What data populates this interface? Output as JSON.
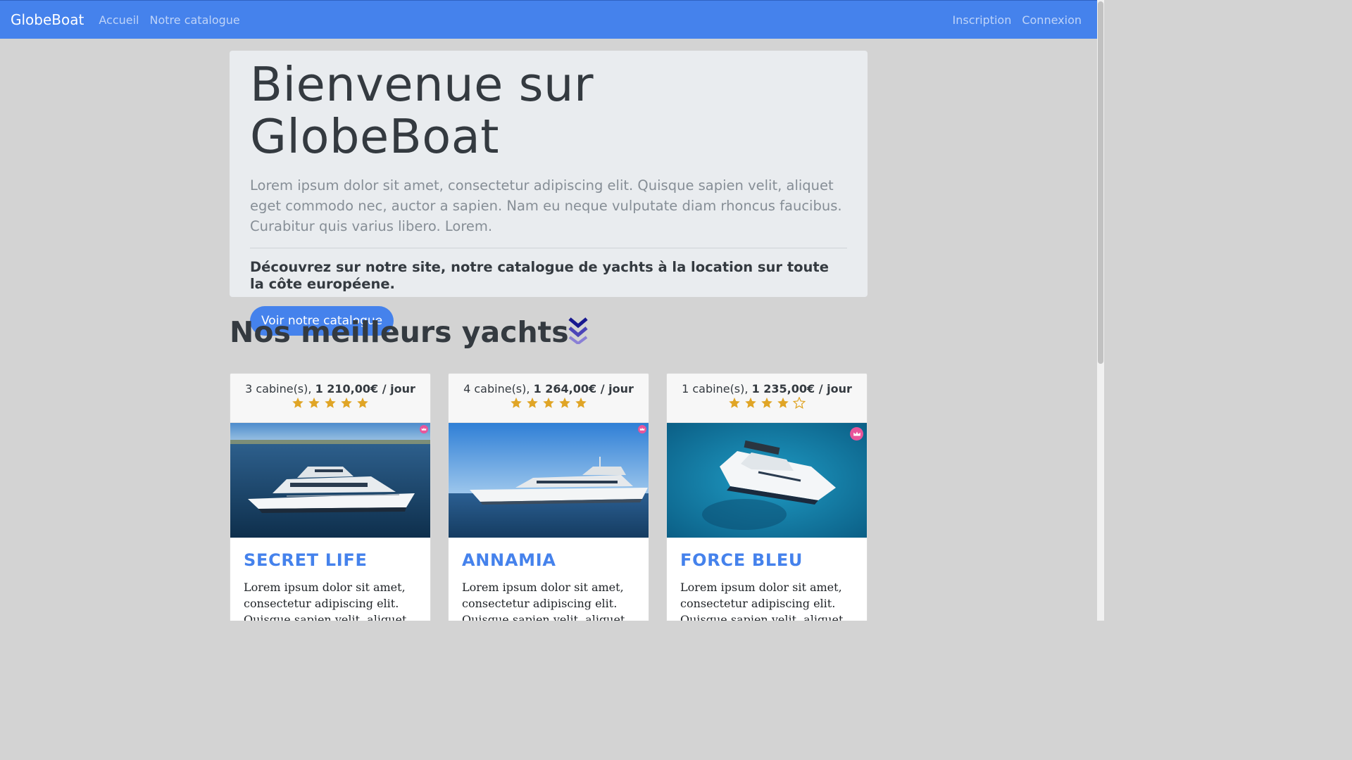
{
  "navbar": {
    "brand": "GlobeBoat",
    "links": [
      "Accueil",
      "Notre catalogue"
    ],
    "right_links": [
      "Inscription",
      "Connexion"
    ]
  },
  "jumbotron": {
    "title": "Bienvenue sur GlobeBoat",
    "lead": "Lorem ipsum dolor sit amet, consectetur adipiscing elit. Quisque sapien velit, aliquet eget commodo nec, auctor a sapien. Nam eu neque vulputate diam rhoncus faucibus. Curabitur quis varius libero. Lorem.",
    "subtitle": "Découvrez sur notre site, notre catalogue de yachts à la location sur toute la côte européene.",
    "button": "Voir notre catalogue"
  },
  "section": {
    "title": "Nos meilleurs yachts"
  },
  "yachts": [
    {
      "cabins": "3 cabine(s),",
      "price": "1 210,00€ / jour",
      "rating": 5,
      "name": "SECRET LIFE",
      "description": "Lorem ipsum dolor sit amet, consectetur adipiscing elit. Quisque sapien velit, aliquet"
    },
    {
      "cabins": "4 cabine(s),",
      "price": "1 264,00€ / jour",
      "rating": 5,
      "name": "ANNAMIA",
      "description": "Lorem ipsum dolor sit amet, consectetur adipiscing elit. Quisque sapien velit, aliquet"
    },
    {
      "cabins": "1 cabine(s),",
      "price": "1 235,00€ / jour",
      "rating": 4,
      "name": "FORCE BLEU",
      "description": "Lorem ipsum dolor sit amet, consectetur adipiscing elit. Quisque sapien velit, aliquet"
    }
  ],
  "colors": {
    "primary": "#4582ec",
    "background": "#d3d3d3",
    "star": "#e0a526",
    "crown_badge": "#e8559a"
  },
  "icons": {
    "star": "star-icon",
    "star_empty": "star-outline-icon",
    "crown": "crown-icon",
    "chevrons": "double-chevron-down-icon"
  }
}
